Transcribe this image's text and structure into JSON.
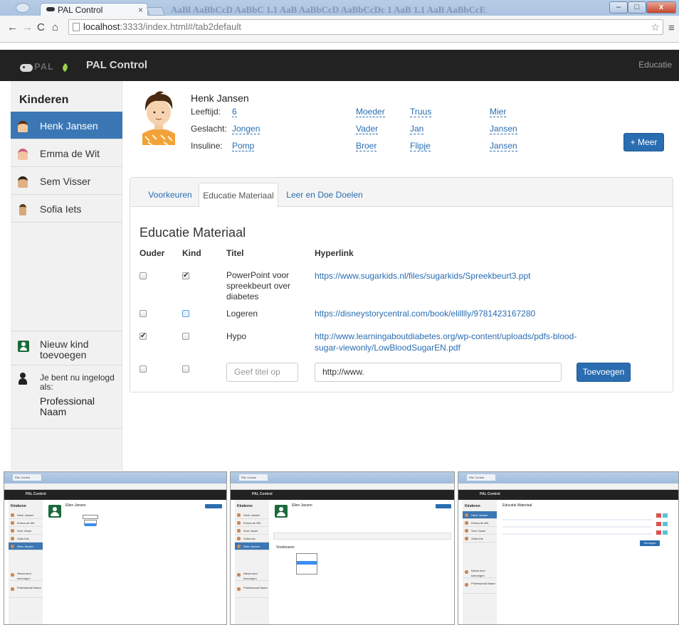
{
  "browser": {
    "tab_title": "PAL Control",
    "tab_close": "×",
    "url_host": "localhost",
    "url_rest": ":3333/index.html#/tab2default",
    "background_ghost_text": "AaBl AaBbCcD AaBbC 1.1 AaB AaBbCcD AaBbCcDc 1 AaB 1.1 AaB AaBbCcE",
    "win_min": "–",
    "win_max": "□",
    "win_close": "x"
  },
  "navbar": {
    "logo_text": "PAL",
    "brand": "PAL Control",
    "right_link": "Educatie"
  },
  "sidebar": {
    "title": "Kinderen",
    "items": [
      {
        "label": "Henk Jansen",
        "active": true,
        "avatar_color": "#f3c9a0"
      },
      {
        "label": "Emma de Wit",
        "active": false,
        "avatar_color": "#e07a8a"
      },
      {
        "label": "Sem Visser",
        "active": false,
        "avatar_color": "#c48a3a"
      },
      {
        "label": "Sofia Iets",
        "active": false,
        "avatar_color": "#8a6a4a"
      }
    ],
    "add_kid": "Nieuw kind toevoegen",
    "login_text": "Je bent nu ingelogd als:",
    "login_name": "Professional Naam"
  },
  "child": {
    "name": "Henk Jansen",
    "props": [
      {
        "label": "Leeftijd:",
        "value": "6"
      },
      {
        "label": "Geslacht:",
        "value": "Jongen"
      },
      {
        "label": "Insuline:",
        "value": "Pomp"
      }
    ],
    "family": [
      {
        "role": "Moeder",
        "first": "Truus",
        "last": "Mier"
      },
      {
        "role": "Vader",
        "first": "Jan",
        "last": "Jansen"
      },
      {
        "role": "Broer",
        "first": "Flipje",
        "last": "Jansen"
      }
    ],
    "more_button": "+ Meer"
  },
  "tabs": [
    {
      "label": "Voorkeuren",
      "active": false
    },
    {
      "label": "Educatie Materiaal",
      "active": true
    },
    {
      "label": "Leer en Doe Doelen",
      "active": false
    }
  ],
  "education": {
    "title": "Educatie Materiaal",
    "columns": [
      "Ouder",
      "Kind",
      "Titel",
      "Hyperlink"
    ],
    "rows": [
      {
        "ouder": false,
        "kind": true,
        "title": "PowerPoint voor spreekbeurt over diabetes",
        "link": "https://www.sugarkids.nl/files/sugarkids/Spreekbeurt3.ppt"
      },
      {
        "ouder": false,
        "kind": false,
        "title": "Logeren",
        "link": "https://disneystorycentral.com/book/elilllly/9781423167280"
      },
      {
        "ouder": true,
        "kind": false,
        "title": "Hypo",
        "link": "http://www.learningaboutdiabetes.org/wp-content/uploads/pdfs-blood-sugar-viewonly/LowBloodSugarEN.pdf"
      }
    ],
    "new_title_placeholder": "Geef titel op",
    "new_link_value": "http://www.",
    "add_button": "Toevoegen"
  },
  "thumbnails": [
    {
      "brand": "PAL Control",
      "sidebar_title": "Kinderen",
      "items": [
        "Henk Jansen",
        "Emma de Wit",
        "Sem Visser",
        "Sofia Iets",
        "Ellen Jansen"
      ],
      "active_index": 4,
      "child_name": "Ellen Jansen",
      "add_kid": "Nieuw kind toevoegen",
      "login_name": "Professional Naam"
    },
    {
      "brand": "PAL Control",
      "sidebar_title": "Kinderen",
      "items": [
        "Henk Jansen",
        "Emma de Wit",
        "Sem Visser",
        "Sofia Iets",
        "Ellen Jansen"
      ],
      "active_index": 4,
      "child_name": "Ellen Jansen",
      "section": "Voorkeuren",
      "add_kid": "Nieuw kind toevoegen",
      "login_name": "Professional Naam"
    },
    {
      "brand": "PAL Control",
      "sidebar_title": "Kinderen",
      "items": [
        "Henk Jansen",
        "Emma de Wit",
        "Sem Visser",
        "Sofia Iets"
      ],
      "active_index": 0,
      "section": "Educatie Materiaal",
      "add_kid": "Nieuw kind toevoegen",
      "login_name": "Professional Naam",
      "add_button": "Toevoegen"
    }
  ]
}
